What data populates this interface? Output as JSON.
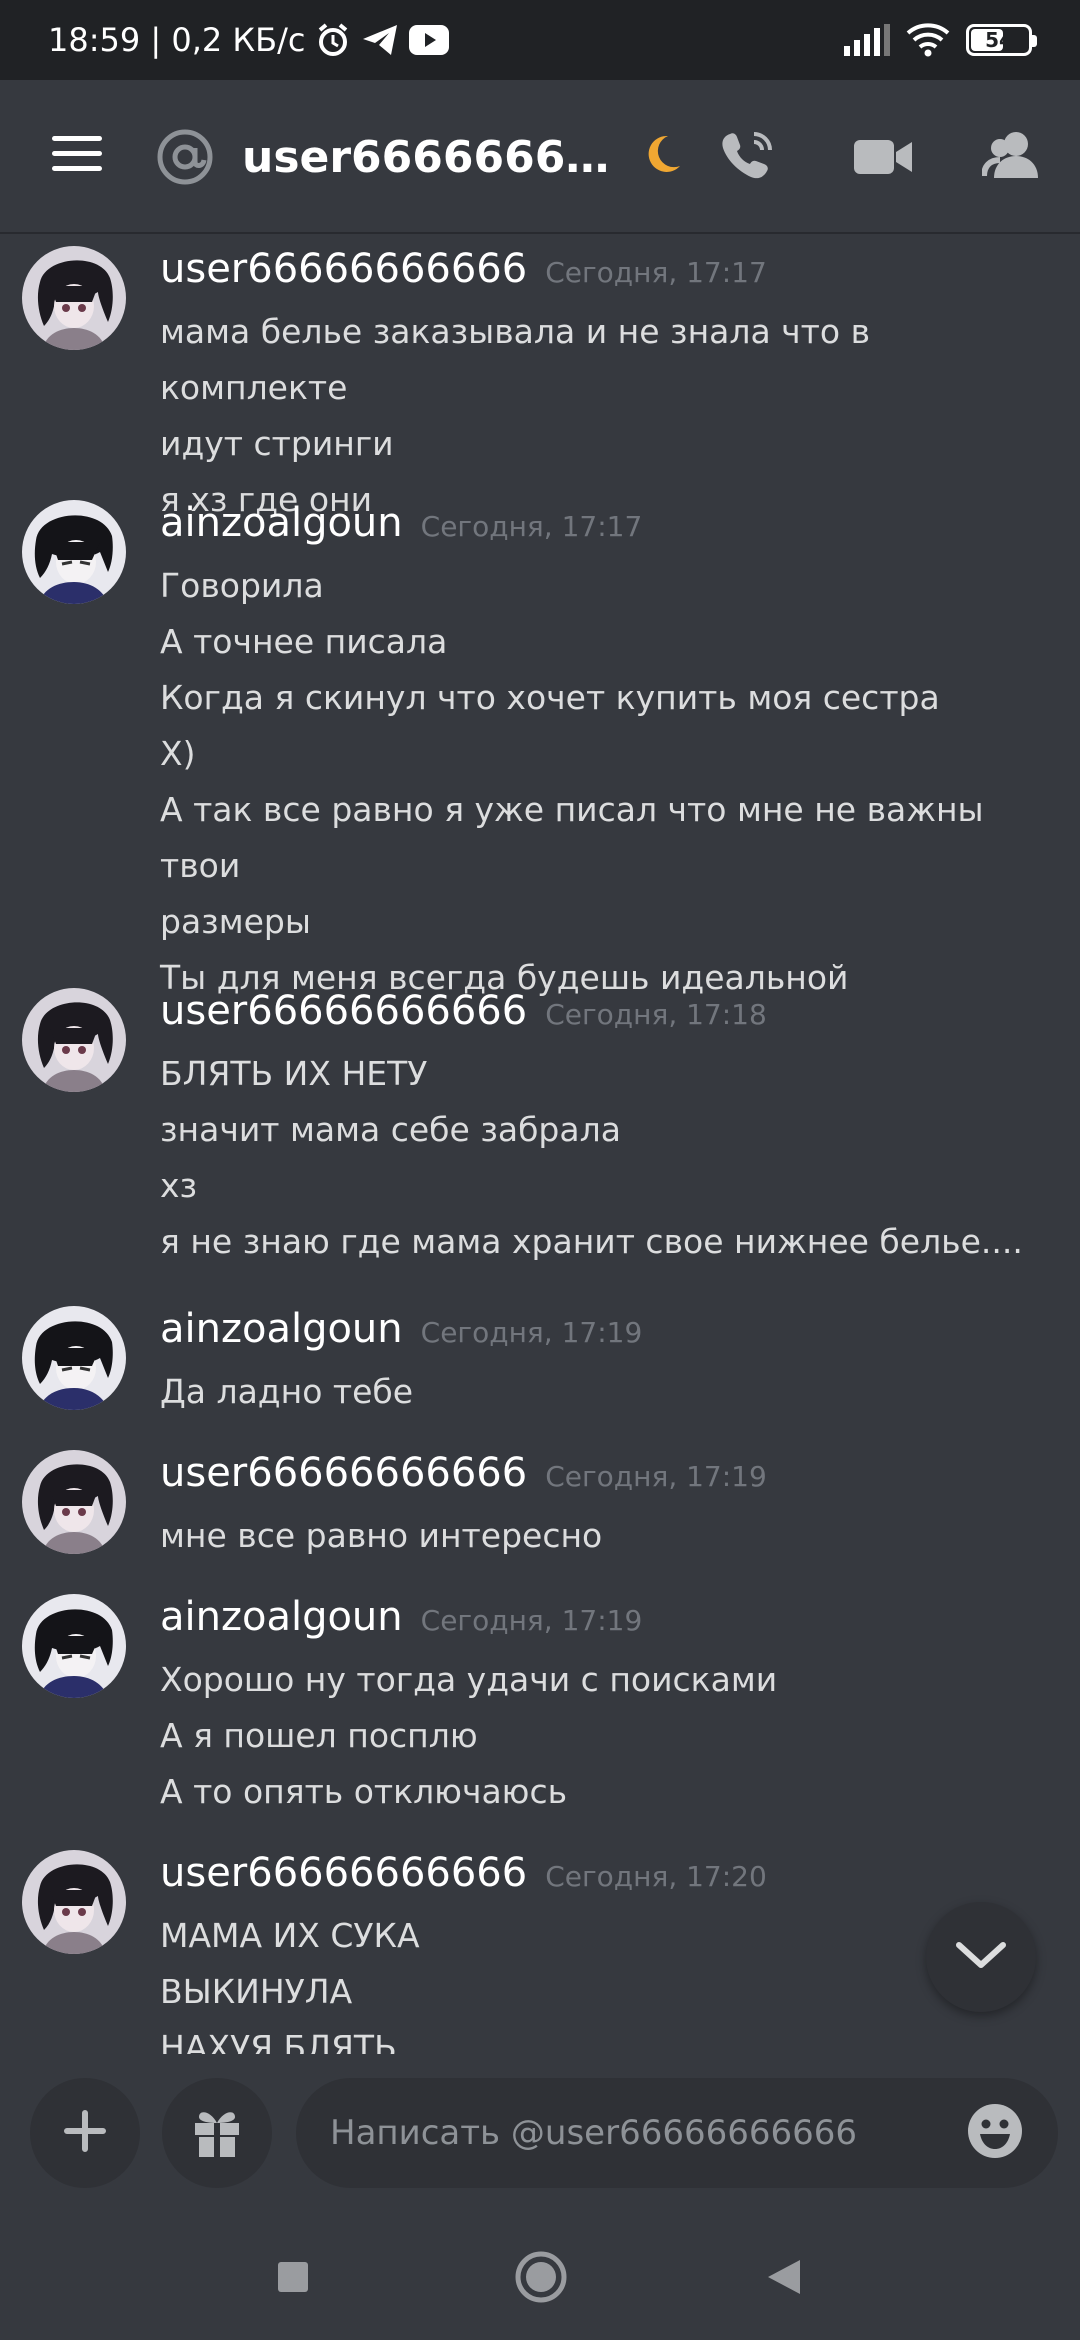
{
  "status_bar": {
    "time_speed": "18:59 | 0,2 КБ/с",
    "battery": "54"
  },
  "header": {
    "title": "user6666666...",
    "icons": [
      "menu-icon",
      "at-icon",
      "moon-icon",
      "voice-call-icon",
      "video-call-icon",
      "members-icon"
    ]
  },
  "messages": [
    {
      "author": "user66666666666",
      "time": "Сегодня, 17:17",
      "lines": [
        "мама белье заказывала и не знала что в комплекте",
        "идут стринги",
        "я хз где они"
      ]
    },
    {
      "author": "ainzoalgoun",
      "time": "Сегодня, 17:17",
      "lines": [
        "Говорила",
        "А точнее писала",
        "Когда я скинул что хочет купить моя сестра",
        "Х)",
        "А так все равно я уже писал что мне не важны твои",
        "размеры",
        "Ты для меня всегда будешь идеальной"
      ]
    },
    {
      "author": "user66666666666",
      "time": "Сегодня, 17:18",
      "lines": [
        "БЛЯТЬ ИХ НЕТУ",
        "значит мама себе забрала",
        "хз",
        "я не знаю где мама хранит свое нижнее белье...."
      ]
    },
    {
      "author": "ainzoalgoun",
      "time": "Сегодня, 17:19",
      "lines": [
        "Да ладно тебе"
      ]
    },
    {
      "author": "user66666666666",
      "time": "Сегодня, 17:19",
      "lines": [
        "мне все равно интересно"
      ]
    },
    {
      "author": "ainzoalgoun",
      "time": "Сегодня, 17:19",
      "lines": [
        "Хорошо ну тогда удачи с поисками",
        "А я пошел посплю",
        "А то опять отключаюсь"
      ]
    },
    {
      "author": "user66666666666",
      "time": "Сегодня, 17:20",
      "lines": [
        "МАМА ИХ СУКА",
        "ВЫКИНУЛА",
        "НАХУЯ БЛЯТЬ"
      ]
    }
  ],
  "composer": {
    "placeholder": "Написать @user66666666666"
  },
  "colors": {
    "background": "#36393f",
    "panel": "#2f3136",
    "muted": "#72767d",
    "moon": "#f0a732"
  }
}
